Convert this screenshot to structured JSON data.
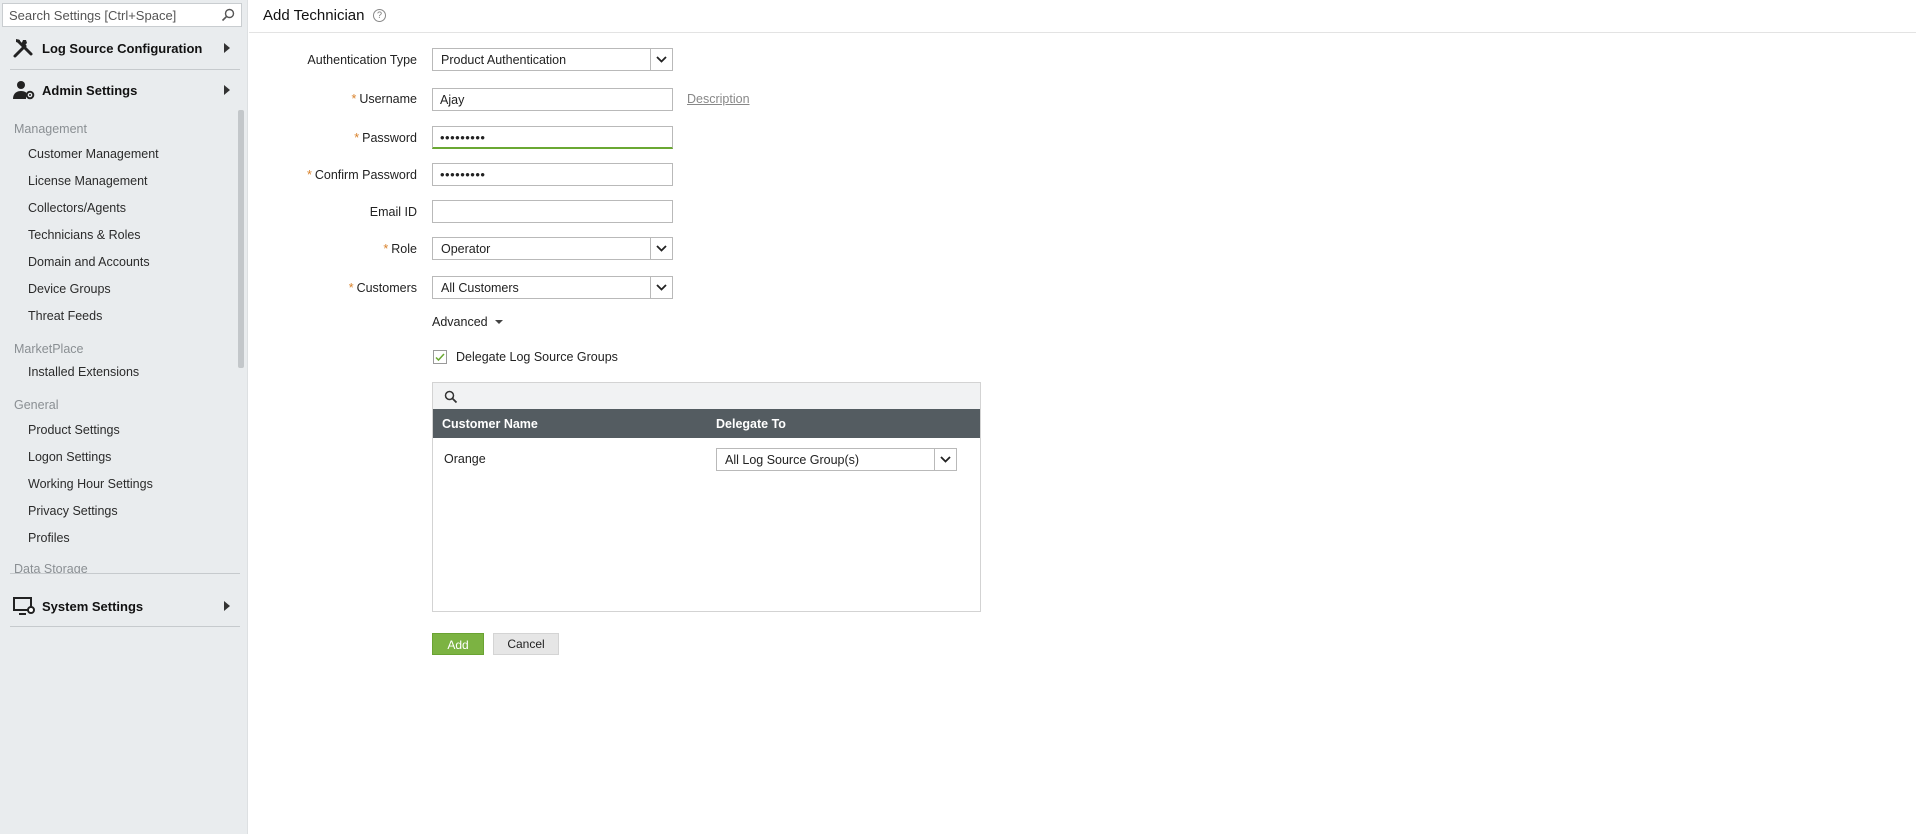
{
  "sidebar": {
    "search": {
      "placeholder": "Search Settings [Ctrl+Space]"
    },
    "sections": {
      "log_source": "Log Source Configuration",
      "admin": "Admin Settings",
      "system": "System Settings"
    },
    "groups": {
      "management": {
        "title": "Management",
        "items": [
          "Customer Management",
          "License Management",
          "Collectors/Agents",
          "Technicians & Roles",
          "Domain and Accounts",
          "Device Groups",
          "Threat Feeds"
        ]
      },
      "marketplace": {
        "title": "MarketPlace",
        "items": [
          "Installed Extensions"
        ]
      },
      "general": {
        "title": "General",
        "items": [
          "Product Settings",
          "Logon Settings",
          "Working Hour Settings",
          "Privacy Settings",
          "Profiles"
        ]
      },
      "data_storage": {
        "title": "Data Storage"
      }
    }
  },
  "page": {
    "title": "Add Technician",
    "help": "?"
  },
  "form": {
    "auth_type": {
      "label": "Authentication Type",
      "value": "Product Authentication"
    },
    "username": {
      "label": "Username",
      "value": "Ajay",
      "description_link": "Description"
    },
    "password": {
      "label": "Password",
      "value": "•••••••••"
    },
    "confirm_password": {
      "label": "Confirm Password",
      "value": "•••••••••"
    },
    "email": {
      "label": "Email ID",
      "value": ""
    },
    "role": {
      "label": "Role",
      "value": "Operator"
    },
    "customers": {
      "label": "Customers",
      "value": "All Customers"
    },
    "required_mark": "*",
    "advanced": "Advanced",
    "delegate": {
      "label": "Delegate Log Source Groups",
      "checked": true
    }
  },
  "grid": {
    "columns": [
      "Customer Name",
      "Delegate To"
    ],
    "rows": [
      {
        "customer": "Orange",
        "delegate_to": "All Log Source Group(s)"
      }
    ]
  },
  "actions": {
    "add": "Add",
    "cancel": "Cancel"
  },
  "colors": {
    "accent_green": "#7cb342",
    "required_orange": "#d9822b",
    "grid_header": "#545c61",
    "sidebar_bg": "#e9ecee"
  }
}
